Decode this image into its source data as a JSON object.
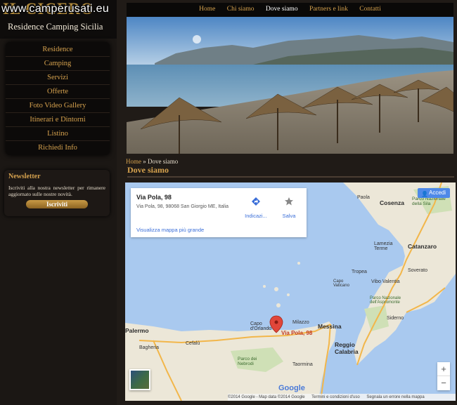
{
  "watermark": "www.camperusati.eu",
  "logo": {
    "title": "IL CICERO",
    "subtitle": "Residence Camping  Sicilia"
  },
  "sidebar": {
    "items": [
      {
        "label": "Residence"
      },
      {
        "label": "Camping"
      },
      {
        "label": "Servizi"
      },
      {
        "label": "Offerte"
      },
      {
        "label": "Foto Video Gallery"
      },
      {
        "label": "Itinerari e Dintorni"
      },
      {
        "label": "Listino"
      },
      {
        "label": "Richiedi Info"
      }
    ]
  },
  "newsletter": {
    "title": "Newsletter",
    "text": "Iscriviti alla nostra newsletter per rimanere aggiornato sulle nostre novità.",
    "button": "Iscriviti"
  },
  "top_nav": {
    "items": [
      {
        "label": "Home"
      },
      {
        "label": "Chi siamo"
      },
      {
        "label": "Dove siamo"
      },
      {
        "label": "Partners e link"
      },
      {
        "label": "Contatti"
      }
    ]
  },
  "breadcrumb": {
    "home": "Home",
    "sep": " » ",
    "current": "Dove siamo"
  },
  "page_title": "Dove siamo",
  "map": {
    "info": {
      "name": "Via Pola, 98",
      "address": "Via Pola, 98, 98068 San Giorgio ME, Italia",
      "link": "Visualizza mappa più grande",
      "directions": "Indicazi...",
      "save": "Salva"
    },
    "login": "Accedi",
    "zoom_in": "+",
    "zoom_out": "−",
    "pin_label": "Via Pola, 98",
    "google": "Google",
    "footer": [
      "©2014 Google - Map data ©2014 Google",
      "Termini e condizioni d'uso",
      "Segnala un errore nella mappa"
    ],
    "places": [
      {
        "name": "Paola"
      },
      {
        "name": "Cosenza"
      },
      {
        "name": "Parco Nazionale della Sila"
      },
      {
        "name": "Lamezia Terme"
      },
      {
        "name": "Catanzaro"
      },
      {
        "name": "Tropea"
      },
      {
        "name": "Vibo Valentia"
      },
      {
        "name": "Soverato"
      },
      {
        "name": "Capo Vaticano"
      },
      {
        "name": "Parco Nazionale dell'Aspromonte"
      },
      {
        "name": "Siderno"
      },
      {
        "name": "Capo d'Orlando"
      },
      {
        "name": "Milazzo"
      },
      {
        "name": "Messina"
      },
      {
        "name": "Reggio Calabria"
      },
      {
        "name": "Palermo"
      },
      {
        "name": "Bagheria"
      },
      {
        "name": "Cefalù"
      },
      {
        "name": "Parco dei Nebrodi"
      },
      {
        "name": "Taormina"
      }
    ],
    "road_color": "#f2b64a",
    "land_color": "#ece7d8",
    "sea_color": "#a9c9ef"
  }
}
